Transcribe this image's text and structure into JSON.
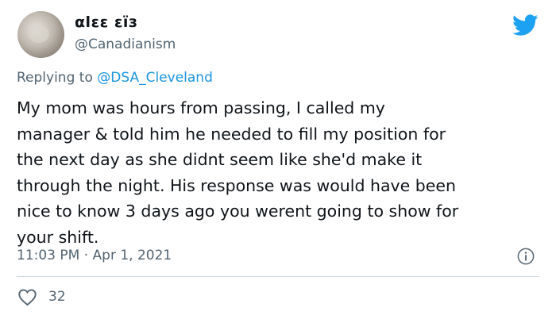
{
  "author": {
    "display_name": "αlεε εїз",
    "handle": "@Canadianism"
  },
  "reply": {
    "prefix": "Replying to ",
    "mention": "@DSA_Cleveland"
  },
  "tweet": {
    "text": "My mom was hours from passing, I called my\nmanager & told him he needed to fill my position for\nthe next day as she didnt seem like she'd make it\nthrough the night. His response was would have been\nnice to know 3 days ago you werent going to show for\nyour shift.",
    "timestamp": "11:03 PM · Apr 1, 2021"
  },
  "engagement": {
    "likes": "32"
  },
  "icons": {
    "brand": "twitter-bird-icon",
    "info": "info-icon",
    "like": "heart-icon"
  },
  "colors": {
    "brand": "#1da1f2",
    "link": "#1b95e0",
    "secondary_text": "#536471"
  }
}
